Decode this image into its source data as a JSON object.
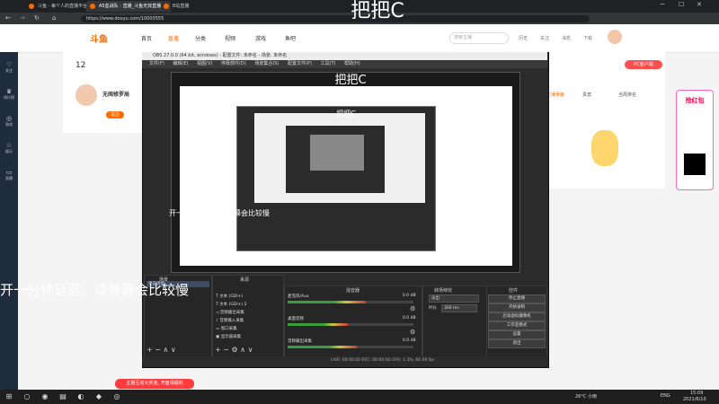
{
  "browser": {
    "tabs": [
      "斗鱼 - 每个人的直播平台",
      "A5血战队 - 直播_斗鱼无双直播",
      "B站直播"
    ],
    "url": "https://www.douyu.com/10003555",
    "stream_overlay_title": "把把C"
  },
  "douyu": {
    "logo": "斗鱼",
    "nav": [
      "首页",
      "直播",
      "分类",
      "视频",
      "游戏",
      "鱼吧"
    ],
    "search_placeholder": "搜索主播",
    "header_icons": [
      "历史",
      "关注",
      "消息",
      "下载",
      "鱼塘"
    ],
    "left_nav": [
      "关注",
      "排行榜",
      "游戏",
      "娱乐",
      "直播"
    ],
    "info": {
      "level": "12",
      "streamer": "无闻修罗局",
      "follow_label": "关注"
    },
    "right": {
      "tabs": [
        "主播贡献",
        "贵宾",
        "当周排名"
      ],
      "pc_button": "PC客户端"
    },
    "red_envelope": "抢红包",
    "promo": "主播互动大奖池, 开盘领福利"
  },
  "obs": {
    "window_title": "OBS 27.0.0 (64 bit, windows) - 配置文件: 未命名 - 场景: 未命名",
    "menu": [
      "文件(F)",
      "编辑(E)",
      "视图(V)",
      "停靠部件(D)",
      "场景集合(S)",
      "配置文件(P)",
      "工具(T)",
      "帮助(H)"
    ],
    "docks": {
      "scenes": "场景",
      "sources": "来源",
      "mixer": "混音器",
      "transitions": "转场特效",
      "controls": "控件"
    },
    "scene_item": "单击场景",
    "sources": [
      "文本 (GDI+)",
      "文本 (GDI+) 2",
      "音频输出采集",
      "音频输入采集",
      "窗口采集",
      "显示器采集"
    ],
    "mixer": [
      {
        "name": "麦克风/Aux",
        "level": 0.62,
        "db": "0.0 dB"
      },
      {
        "name": "桌面音频",
        "level": 0.48,
        "db": "0.0 dB"
      },
      {
        "name": "音频输出采集",
        "level": 0.55,
        "db": "0.0 dB"
      }
    ],
    "transition": {
      "type": "淡出",
      "duration_label": "时长",
      "duration": "300 ms"
    },
    "controls": [
      "停止直播",
      "开始录制",
      "启动虚拟摄像机",
      "工作室模式",
      "设置",
      "退出"
    ],
    "status": "LIVE: 00:00:00   REC: 00:00:00   CPU: 1.3%, 60.00 fps"
  },
  "overlay": {
    "danmaku_mid": "开一分钟延迟，读弹幕会比较慢",
    "danmaku_big": "开一分钟延迟，读弹幕会比较慢"
  },
  "taskbar": {
    "weather": "26°C 小雨",
    "lang": "ENG",
    "time": "15:09",
    "date": "2021/6/10"
  }
}
